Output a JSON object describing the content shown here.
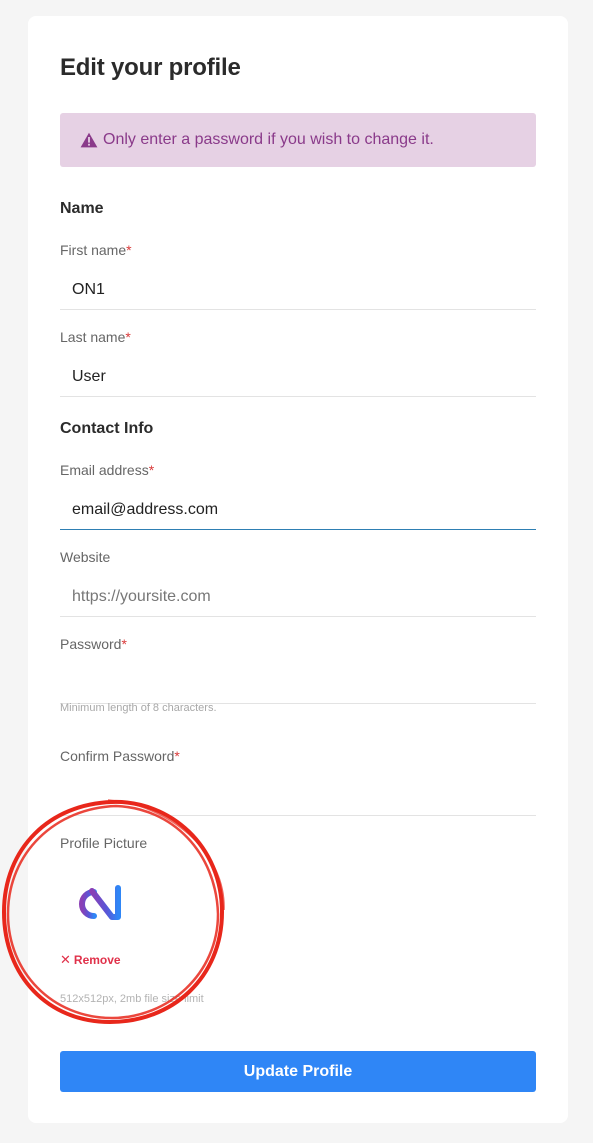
{
  "page": {
    "title": "Edit your profile",
    "alert": {
      "icon": "warning-icon",
      "text": "Only enter a password if you wish to change it."
    }
  },
  "sections": {
    "name": "Name",
    "contact": "Contact Info"
  },
  "fields": {
    "first_name": {
      "label": "First name",
      "required_mark": "*",
      "value": "ON1"
    },
    "last_name": {
      "label": "Last name",
      "required_mark": "*",
      "value": "User"
    },
    "email": {
      "label": "Email address",
      "required_mark": "*",
      "value": "email@address.com"
    },
    "website": {
      "label": "Website",
      "placeholder": "https://yoursite.com",
      "value": ""
    },
    "password": {
      "label": "Password",
      "required_mark": "*",
      "value": "",
      "hint": "Minimum length of 8 characters."
    },
    "confirm_password": {
      "label": "Confirm Password",
      "required_mark": "*",
      "value": ""
    }
  },
  "profile_picture": {
    "label": "Profile Picture",
    "logo": "on1-logo",
    "remove_label": "Remove",
    "remove_icon": "close-icon",
    "hint": "512x512px, 2mb file size limit"
  },
  "submit_label": "Update Profile",
  "colors": {
    "accent": "#2f86f6",
    "alert_bg": "#e6d1e4",
    "alert_text": "#8a3a8a",
    "required": "#d93a3a",
    "remove": "#e0314a",
    "annotation_circle": "#e8271b"
  }
}
